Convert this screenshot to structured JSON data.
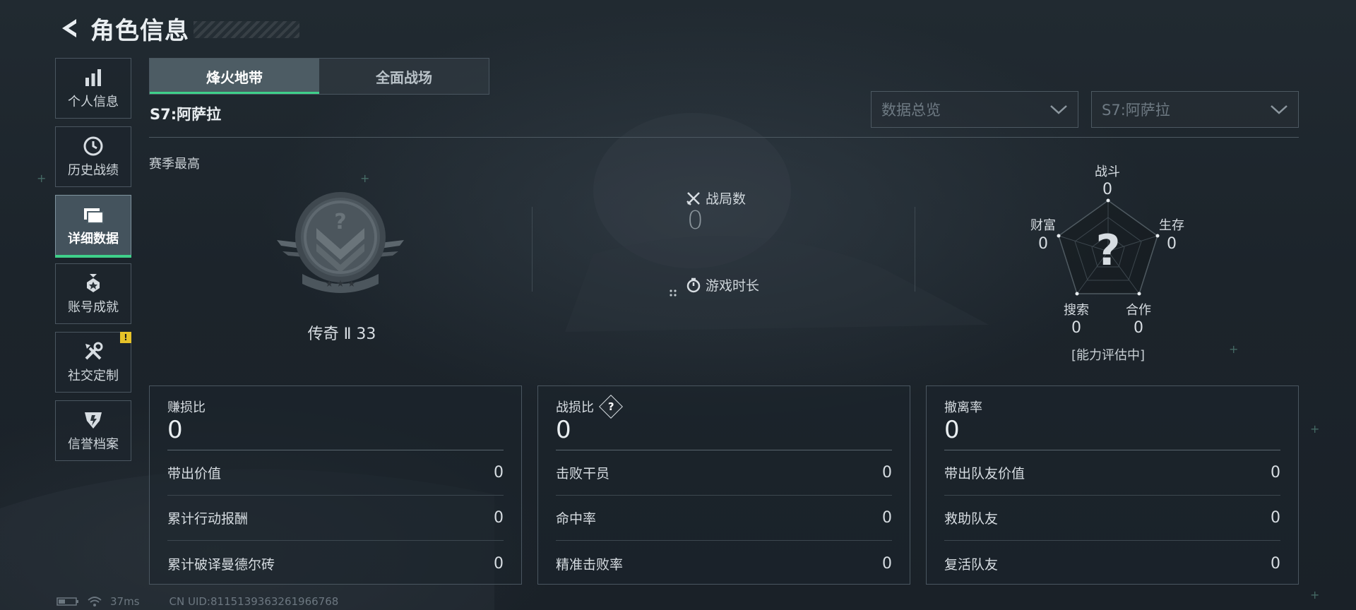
{
  "header": {
    "title": "角色信息"
  },
  "sidebar": {
    "items": [
      {
        "label": "个人信息",
        "icon": "bar-chart-icon"
      },
      {
        "label": "历史战绩",
        "icon": "clock-icon"
      },
      {
        "label": "详细数据",
        "icon": "folder-icon",
        "active": true
      },
      {
        "label": "账号成就",
        "icon": "medal-icon"
      },
      {
        "label": "社交定制",
        "icon": "tools-icon",
        "badge": "!"
      },
      {
        "label": "信誉档案",
        "icon": "shield-icon"
      }
    ]
  },
  "tabs": [
    {
      "label": "烽火地带",
      "active": true
    },
    {
      "label": "全面战场",
      "active": false
    }
  ],
  "season": {
    "name": "S7:阿萨拉",
    "best_label": "赛季最高",
    "rank": "传奇 Ⅱ 33"
  },
  "filters": {
    "view": "数据总览",
    "season": "S7:阿萨拉"
  },
  "summary": {
    "battles_label": "战局数",
    "battles_value": "0",
    "playtime_label": "游戏时长"
  },
  "radar": {
    "axes": [
      {
        "label": "战斗",
        "value": "0"
      },
      {
        "label": "生存",
        "value": "0"
      },
      {
        "label": "合作",
        "value": "0"
      },
      {
        "label": "搜索",
        "value": "0"
      },
      {
        "label": "财富",
        "value": "0"
      }
    ],
    "center": "?",
    "status": "[能力评估中]"
  },
  "cards": [
    {
      "title": "赚损比",
      "value": "0",
      "rows": [
        {
          "label": "带出价值",
          "value": "0"
        },
        {
          "label": "累计行动报酬",
          "value": "0"
        },
        {
          "label": "累计破译曼德尔砖",
          "value": "0"
        }
      ]
    },
    {
      "title": "战损比",
      "value": "0",
      "help": "?",
      "rows": [
        {
          "label": "击败干员",
          "value": "0"
        },
        {
          "label": "命中率",
          "value": "0"
        },
        {
          "label": "精准击败率",
          "value": "0"
        }
      ]
    },
    {
      "title": "撤离率",
      "value": "0",
      "rows": [
        {
          "label": "带出队友价值",
          "value": "0"
        },
        {
          "label": "救助队友",
          "value": "0"
        },
        {
          "label": "复活队友",
          "value": "0"
        }
      ]
    }
  ],
  "footer": {
    "ping": "37ms",
    "uid": "CN UID:8115139363261966768"
  },
  "colors": {
    "accent": "#3fd08a",
    "warning": "#e6c229",
    "background": "#1b2229"
  }
}
